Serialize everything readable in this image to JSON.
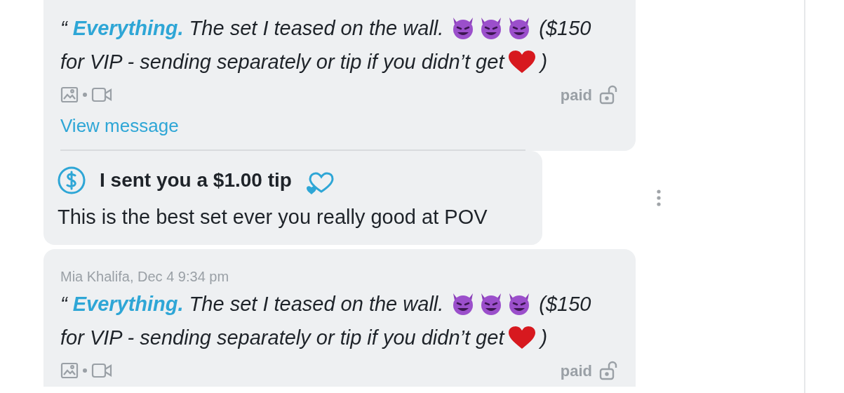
{
  "messages": [
    {
      "kind": "post",
      "quote_mark": "“",
      "highlight": "Everything.",
      "text_before": "The set I teased on the wall.",
      "text_after": "($150",
      "text_line2": "for VIP - sending separately or tip if you didn’t get",
      "text_close": ")",
      "price_label": "paid",
      "locked": false,
      "link": "View message"
    },
    {
      "kind": "tip",
      "title": "I sent you a $1.00 tip",
      "text": "This is the best set ever you really good at POV"
    },
    {
      "kind": "post",
      "sender_line": "Mia Khalifa, Dec 4 9:34 pm",
      "quote_mark": "“",
      "highlight": "Everything.",
      "text_before": "The set I teased on the wall.",
      "text_after": "($150",
      "text_line2": "for VIP - sending separately or tip if you didn’t get",
      "text_close": ")",
      "price_label": "paid",
      "locked": false
    }
  ]
}
